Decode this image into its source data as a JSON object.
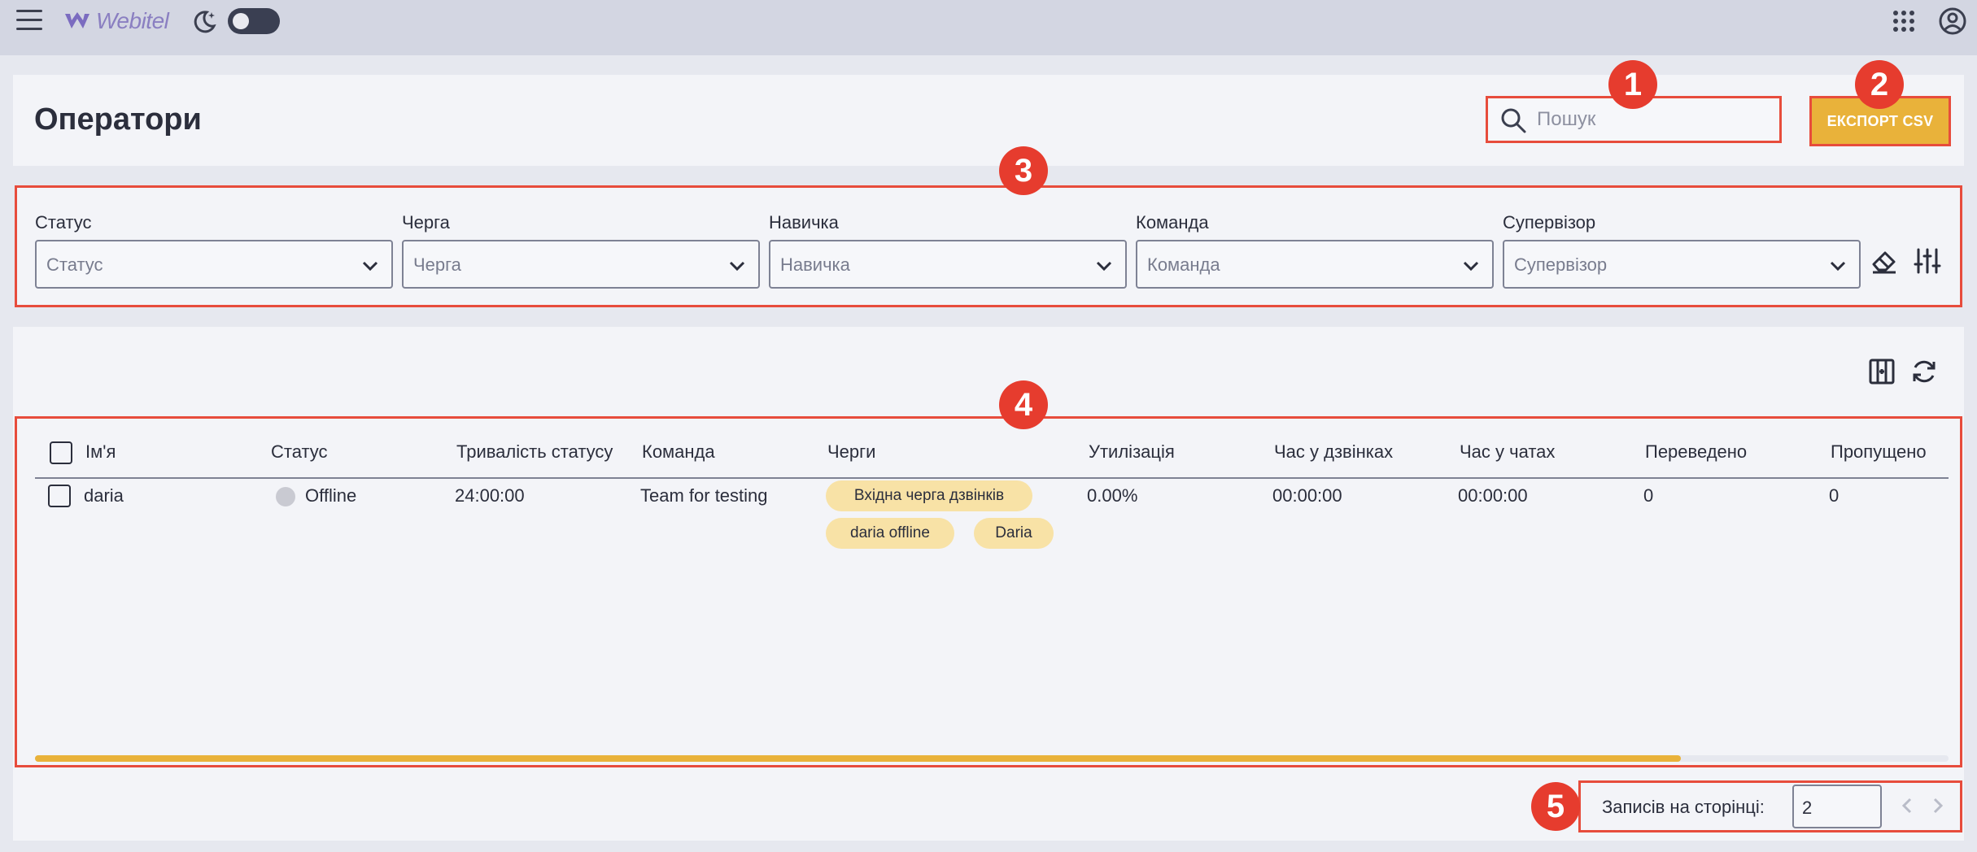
{
  "app": {
    "logo_text": "Webitel"
  },
  "header": {
    "title": "Оператори",
    "search_placeholder": "Пошук",
    "export_label": "ЕКСПОРТ CSV"
  },
  "annotations": [
    "1",
    "2",
    "3",
    "4",
    "5"
  ],
  "filters": [
    {
      "label": "Статус",
      "placeholder": "Статус"
    },
    {
      "label": "Черга",
      "placeholder": "Черга"
    },
    {
      "label": "Навичка",
      "placeholder": "Навичка"
    },
    {
      "label": "Команда",
      "placeholder": "Команда"
    },
    {
      "label": "Супервізор",
      "placeholder": "Супервізор"
    }
  ],
  "table": {
    "columns": [
      "Ім'я",
      "Статус",
      "Тривалість статусу",
      "Команда",
      "Черги",
      "Утилізація",
      "Час у дзвінках",
      "Час у чатах",
      "Переведено",
      "Пропущено"
    ],
    "rows": [
      {
        "name": "daria",
        "status": "Offline",
        "status_duration": "24:00:00",
        "team": "Team for testing",
        "queues": [
          "Вхідна черга дзвінків",
          "daria offline",
          "Daria"
        ],
        "utilization": "0.00%",
        "call_time": "00:00:00",
        "chat_time": "00:00:00",
        "transferred": "0",
        "missed": "0"
      }
    ],
    "horizontal_scroll_visible_fraction": 0.86
  },
  "pagination": {
    "label": "Записів на сторінці:",
    "size": "2"
  },
  "colors": {
    "accent": "#e9b23a",
    "annotation": "#e63c2e",
    "chip": "#f8e2a6",
    "topbar": "#d3d6e2"
  }
}
